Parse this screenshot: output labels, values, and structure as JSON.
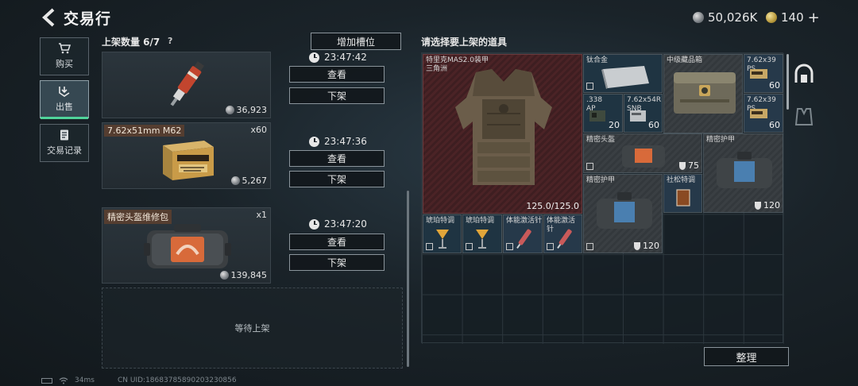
{
  "header": {
    "title": "交易行",
    "currency": [
      {
        "icon": "silver-coin-icon",
        "value": "50,026K"
      },
      {
        "icon": "gold-coin-icon",
        "value": "140"
      }
    ],
    "plus_label": "+"
  },
  "nav": [
    {
      "label": "购买",
      "icon": "cart-icon",
      "active": false
    },
    {
      "label": "出售",
      "icon": "sell-icon",
      "active": true
    },
    {
      "label": "交易记录",
      "icon": "record-icon",
      "active": false
    }
  ],
  "listings": {
    "slots_label": "上架数量 6/7",
    "help": "?",
    "add_slot_button": "增加槽位",
    "view_button": "查看",
    "delist_button": "下架",
    "items": [
      {
        "name": "",
        "quantity": "",
        "price": "36,923",
        "timer": "23:47:42"
      },
      {
        "name": "7.62x51mm M62",
        "quantity": "x60",
        "price": "5,267",
        "timer": "23:47:36"
      },
      {
        "name": "精密头盔维修包",
        "quantity": "x1",
        "price": "139,845",
        "timer": "23:47:20"
      }
    ],
    "empty_slot_label": "等待上架"
  },
  "inventory": {
    "title": "请选择要上架的道具",
    "sort_button": "整理",
    "items": {
      "armor": {
        "label": "特里克MAS2.0装甲\n三角洲",
        "durability": "125.0/125.0"
      },
      "titanium": {
        "label": "钛合金"
      },
      "mid_box": {
        "label": "中级藏品箱"
      },
      "ammo_ps_1": {
        "label": "7.62x39\nPS",
        "count": "60"
      },
      "ammo_ps_2": {
        "label": "7.62x39\nPS",
        "count": "60"
      },
      "ammo_338": {
        "label": ".338\nAP",
        "count": "20"
      },
      "ammo_54r": {
        "label": "7.62x54R\nSNB",
        "count": "60"
      },
      "helmet_kit": {
        "label": "精密头盔",
        "durability": "75"
      },
      "armor_kit_1": {
        "label": "精密护甲"
      },
      "armor_kit_2": {
        "label": "精密护甲",
        "durability": "120"
      },
      "armor_kit_3": {
        "durability": "120"
      },
      "whisky": {
        "label": "社松特调"
      },
      "cocktail_1": {
        "label": "琥珀特调"
      },
      "cocktail_2": {
        "label": "琥珀特调"
      },
      "injector_1": {
        "label": "体能激活针"
      },
      "injector_2": {
        "label": "体能激活针"
      }
    }
  },
  "footer": {
    "ping": "34ms",
    "uid": "CN UID:18683785890203230856"
  }
}
